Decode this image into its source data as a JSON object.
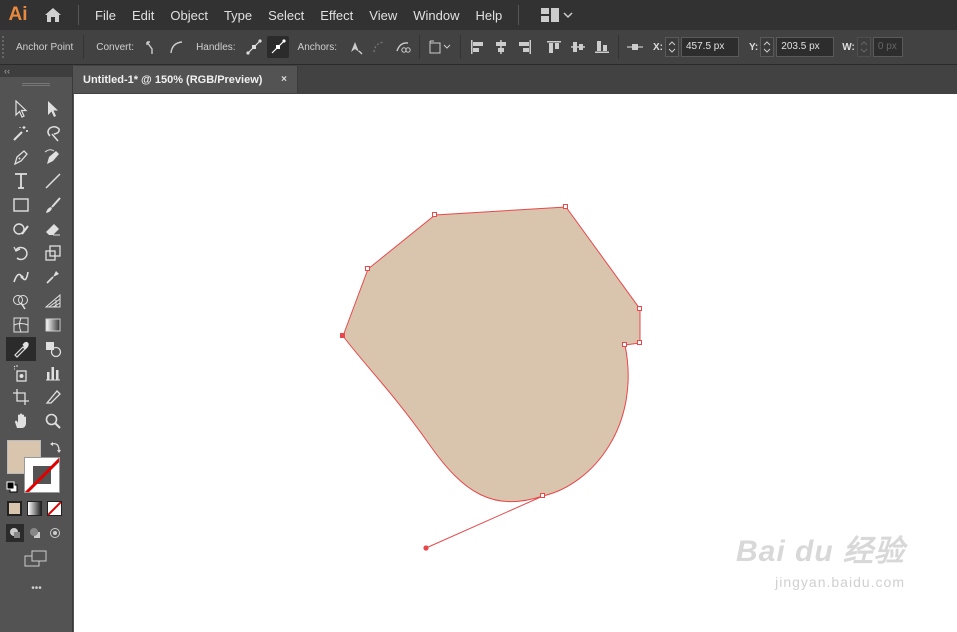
{
  "app": {
    "logo": "Ai"
  },
  "menu": [
    "File",
    "Edit",
    "Object",
    "Type",
    "Select",
    "Effect",
    "View",
    "Window",
    "Help"
  ],
  "control_bar": {
    "anchor_point_label": "Anchor Point",
    "convert_label": "Convert:",
    "handles_label": "Handles:",
    "anchors_label": "Anchors:",
    "x_label": "X:",
    "x_value": "457.5 px",
    "y_label": "Y:",
    "y_value": "203.5 px",
    "w_label": "W:",
    "w_value": "0 px"
  },
  "toolbar": {
    "collapse_glyph": "‹‹",
    "more_glyph": "•••"
  },
  "document": {
    "tab_title": "Untitled-1* @ 150% (RGB/Preview)",
    "close_glyph": "×"
  },
  "artwork": {
    "fill_color": "#d9c5ad",
    "path_color": "#e8474b"
  },
  "watermark": {
    "brand": "Bai du 经验",
    "url": "jingyan.baidu.com"
  }
}
